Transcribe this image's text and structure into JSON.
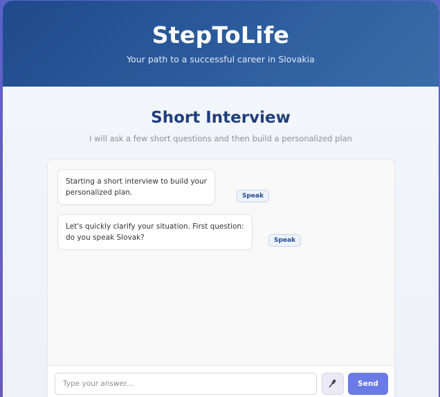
{
  "header": {
    "title": "StepToLife",
    "subtitle": "Your path to a successful career in Slovakia"
  },
  "section": {
    "title": "Short Interview",
    "subtitle": "I will ask a few short questions and then build a personalized plan"
  },
  "chat": {
    "messages": [
      {
        "line1": "Starting a short interview to build your",
        "line2": "personalized plan.",
        "speak_label": "Speak"
      },
      {
        "line1": "Let's quickly clarify your situation. First question:",
        "line2": "do you speak Slovak?",
        "speak_label": "Speak"
      }
    ]
  },
  "input_bar": {
    "placeholder": "Type your answer...",
    "mic_icon": "microphone-icon",
    "send_label": "Send"
  },
  "colors": {
    "header_start": "#1f4a8c",
    "accent": "#6a7be8",
    "title": "#1f3f7a"
  }
}
